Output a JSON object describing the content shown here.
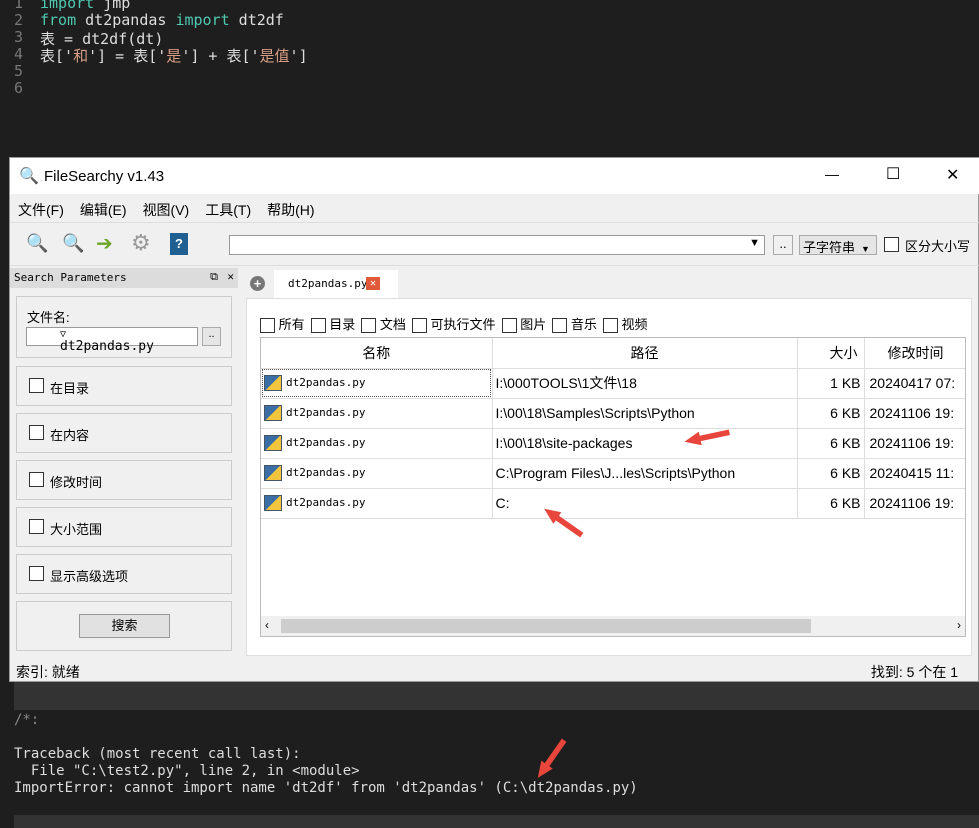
{
  "editor": {
    "line_numbers": [
      "1",
      "2",
      "3",
      "4",
      "5",
      "6"
    ],
    "lines": [
      [
        {
          "t": "import",
          "c": "kw"
        },
        {
          "t": " jmp",
          "c": ""
        }
      ],
      [
        {
          "t": "from",
          "c": "kw"
        },
        {
          "t": " dt2pandas ",
          "c": ""
        },
        {
          "t": "import",
          "c": "kw"
        },
        {
          "t": " dt2df",
          "c": ""
        }
      ],
      [
        {
          "t": "表 = dt2df(dt)",
          "c": ""
        }
      ],
      [
        {
          "t": "表['",
          "c": ""
        },
        {
          "t": "和",
          "c": "str"
        },
        {
          "t": "'] = 表['",
          "c": ""
        },
        {
          "t": "是",
          "c": "str"
        },
        {
          "t": "'] + 表['",
          "c": ""
        },
        {
          "t": "是值",
          "c": "str"
        },
        {
          "t": "']",
          "c": ""
        }
      ],
      [],
      []
    ]
  },
  "window": {
    "title": "FileSearchy v1.43",
    "minimize": "—",
    "maximize": "☐",
    "close": "✕"
  },
  "menu": [
    "文件(F)",
    "编辑(E)",
    "视图(V)",
    "工具(T)",
    "帮助(H)"
  ],
  "toolbar": {
    "search_value": "",
    "match_mode": "子字符串",
    "case_label": "区分大小写",
    "browse": ".."
  },
  "panel": {
    "title": "Search Parameters",
    "filename_label": "文件名:",
    "filename_value": "dt2pandas.py",
    "browse": "..",
    "options": [
      "在目录",
      "在内容",
      "修改时间",
      "大小范围",
      "显示高级选项"
    ],
    "search_button": "搜索"
  },
  "tab": {
    "label": "dt2pandas.py"
  },
  "filters": [
    "所有",
    "目录",
    "文档",
    "可执行文件",
    "图片",
    "音乐",
    "视频"
  ],
  "table": {
    "headers": [
      "名称",
      "路径",
      "大小",
      "修改时间"
    ],
    "rows": [
      [
        "dt2pandas.py",
        "I:\\000TOOLS\\1文件\\18",
        "1 KB",
        "20240417 07:"
      ],
      [
        "dt2pandas.py",
        "I:\\00\\18\\Samples\\Scripts\\Python",
        "6 KB",
        "20241106 19:"
      ],
      [
        "dt2pandas.py",
        "I:\\00\\18\\site-packages",
        "6 KB",
        "20241106 19:"
      ],
      [
        "dt2pandas.py",
        "C:\\Program Files\\J...les\\Scripts\\Python",
        "6 KB",
        "20240415 11:"
      ],
      [
        "dt2pandas.py",
        "C:",
        "6 KB",
        "20241106 19:"
      ]
    ]
  },
  "status": {
    "left": "索引: 就绪",
    "right": "找到: 5 个在 1"
  },
  "console": {
    "lines": [
      "/*:",
      "",
      "Traceback (most recent call last):",
      "  File \"C:\\test2.py\", line 2, in <module>",
      "ImportError: cannot import name 'dt2df' from 'dt2pandas' (C:\\dt2pandas.py)"
    ]
  },
  "colors": {
    "annotation_arrow": "#e8453c",
    "keyword": "#4ec9b0",
    "string": "#d69d85"
  }
}
